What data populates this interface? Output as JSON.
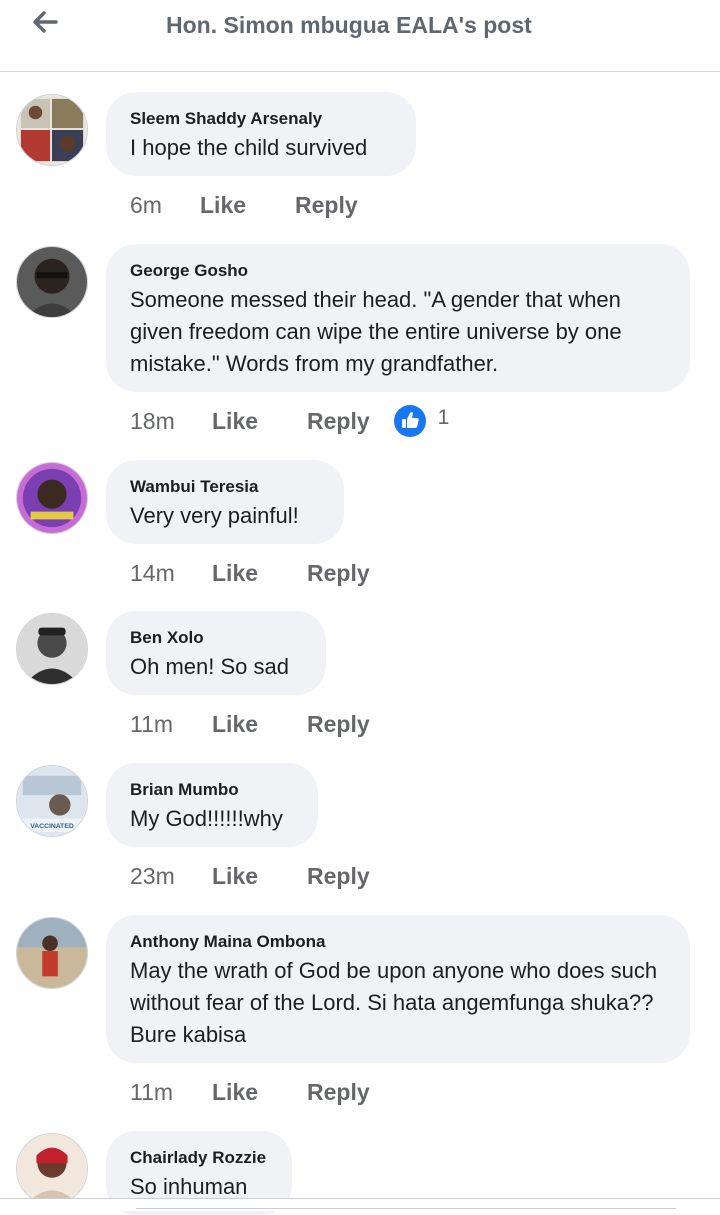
{
  "header": {
    "title": "Hon. Simon mbugua EALA's post"
  },
  "icons": {
    "back": "arrow-left-icon",
    "like_reaction": "thumbs-up-icon"
  },
  "colors": {
    "accent": "#1877f2",
    "bubble": "#f0f2f5",
    "muted": "#65676b"
  },
  "actions": {
    "like": "Like",
    "reply": "Reply"
  },
  "comments": [
    {
      "author": "Sleem Shaddy Arsenaly",
      "text": "I hope the child survived",
      "time": "6m"
    },
    {
      "author": "George Gosho",
      "text": "Someone messed their head. \"A gender that when given freedom can wipe the entire universe by one mistake.\" Words from my grandfather.",
      "time": "18m",
      "reactions": "1"
    },
    {
      "author": "Wambui Teresia",
      "text": "Very very painful!",
      "time": "14m"
    },
    {
      "author": "Ben Xolo",
      "text": "Oh men! So sad",
      "time": "11m"
    },
    {
      "author": "Brian Mumbo",
      "text": "My God!!!!!!why",
      "time": "23m"
    },
    {
      "author": "Anthony Maina Ombona",
      "text": "May the wrath of God be upon anyone who does such without fear of the Lord. Si hata angemfunga shuka?? Bure kabisa",
      "time": "11m"
    },
    {
      "author": "Chairlady Rozzie",
      "text": "So inhuman"
    }
  ]
}
